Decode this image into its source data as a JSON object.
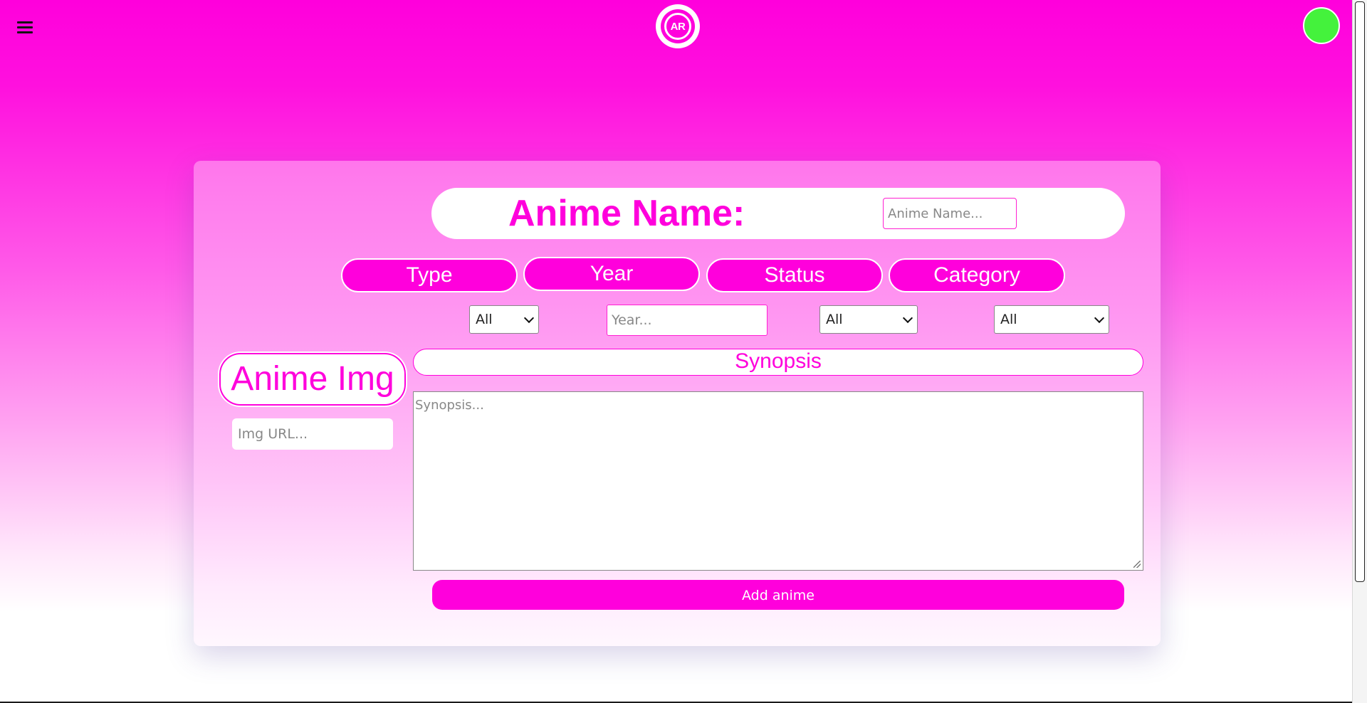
{
  "header": {
    "menu_icon": "hamburger-menu-icon",
    "logo_text": "AR",
    "avatar_color": "#44f23c"
  },
  "form": {
    "name_label": "Anime Name:",
    "name_placeholder": "Anime Name...",
    "filters": {
      "type_label": "Type",
      "year_label": "Year",
      "status_label": "Status",
      "category_label": "Category",
      "type_value": "All",
      "year_placeholder": "Year...",
      "status_value": "All",
      "category_value": "All"
    },
    "img_label": "Anime Img",
    "img_placeholder": "Img URL...",
    "synopsis_label": "Synopsis",
    "synopsis_placeholder": "Synopsis...",
    "submit_label": "Add anime"
  },
  "colors": {
    "accent": "#ff00dc",
    "white": "#ffffff"
  }
}
